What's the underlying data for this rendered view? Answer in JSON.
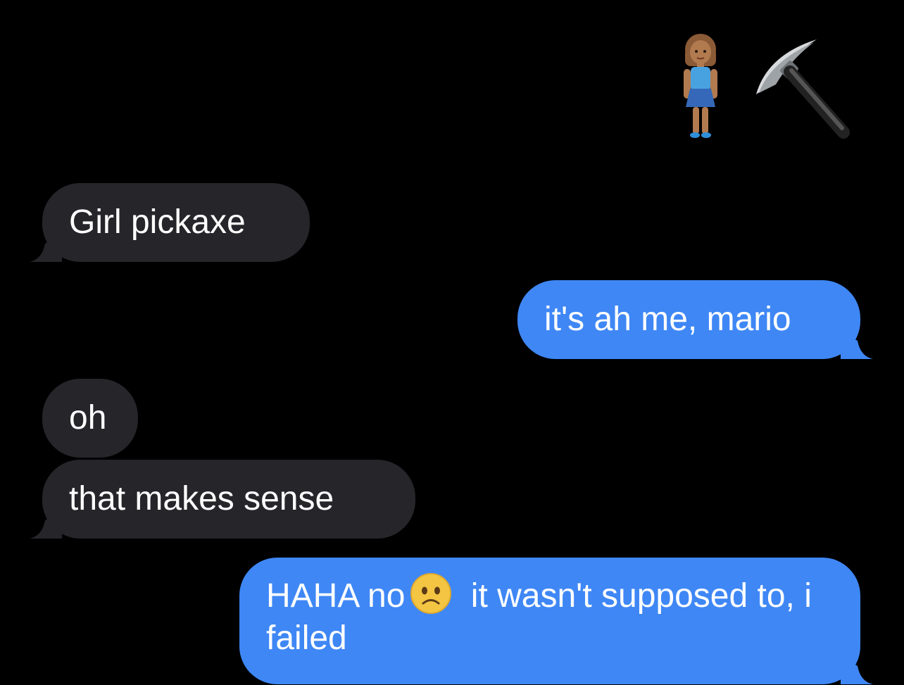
{
  "messages": {
    "emoji_names": [
      "woman-standing-icon",
      "pickaxe-icon"
    ],
    "m1": "Girl pickaxe",
    "m2": "it's ah me, mario",
    "m3": "oh",
    "m4": "that makes sense",
    "m5_before": "HAHA no",
    "m5_after": " it wasn't supposed to, i failed",
    "m5_emoji": "slightly-frowning-face-icon"
  },
  "colors": {
    "background": "#000000",
    "incoming_bubble": "#26252a",
    "outgoing_bubble": "#3f87f5",
    "text": "#ffffff"
  }
}
